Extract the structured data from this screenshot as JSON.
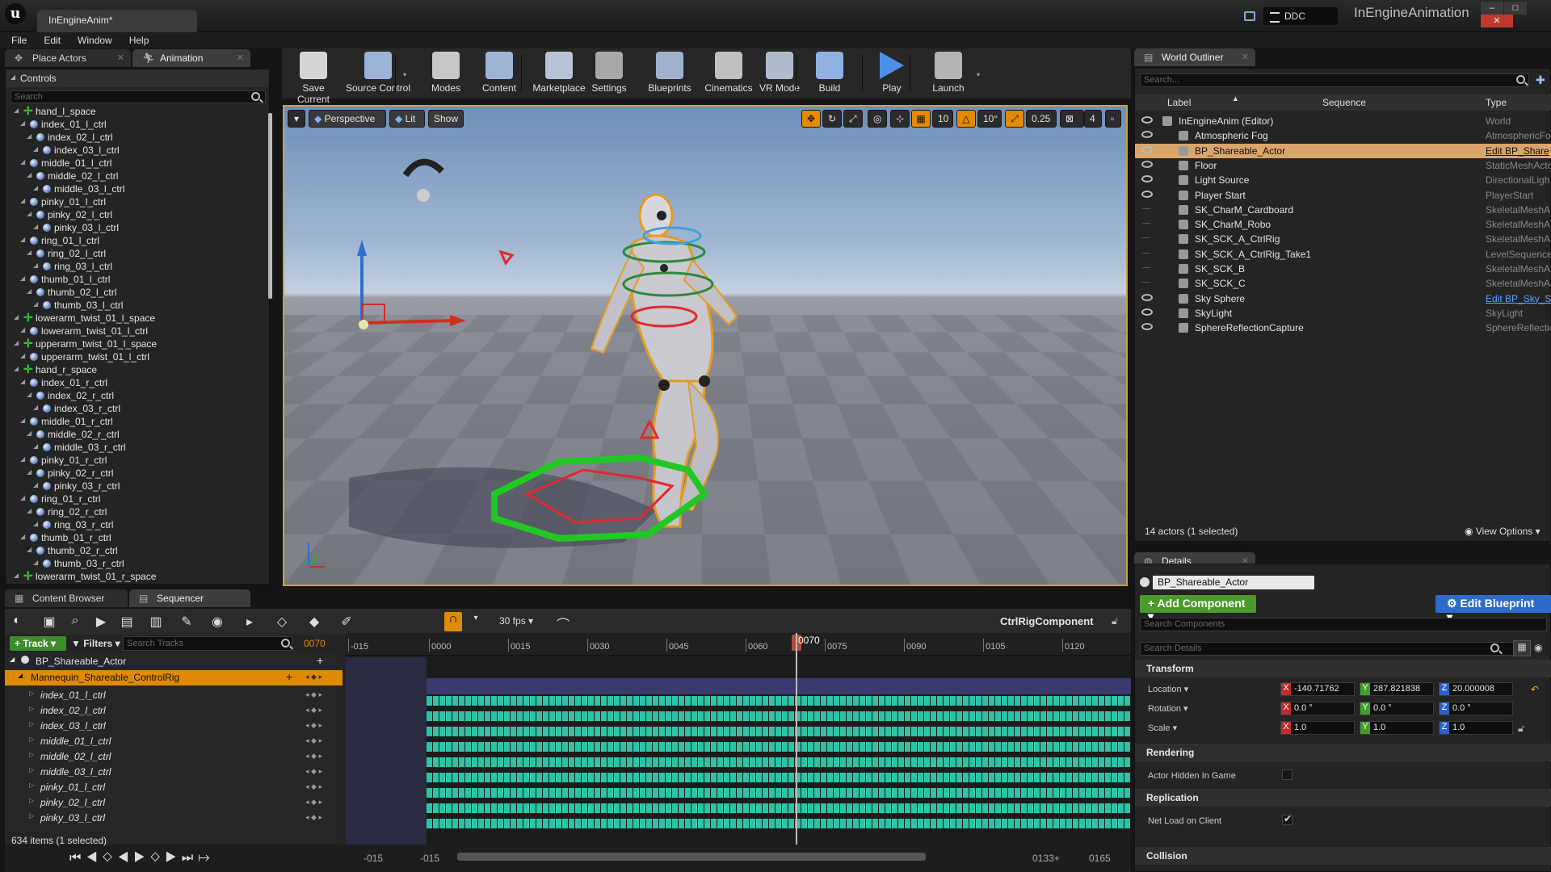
{
  "titlebar": {
    "doc_tab": "InEngineAnim*",
    "project": "InEngineAnimation",
    "ddc": "DDC"
  },
  "menu": [
    "File",
    "Edit",
    "Window",
    "Help"
  ],
  "left_tabs": {
    "place_actors": "Place Actors",
    "animation": "Animation"
  },
  "controls": {
    "header": "Controls",
    "search_placeholder": "Search",
    "items": [
      {
        "label": "hand_l_space",
        "depth": 0,
        "kind": "space"
      },
      {
        "label": "index_01_l_ctrl",
        "depth": 1,
        "kind": "ctrl"
      },
      {
        "label": "index_02_l_ctrl",
        "depth": 2,
        "kind": "ctrl"
      },
      {
        "label": "index_03_l_ctrl",
        "depth": 3,
        "kind": "ctrl"
      },
      {
        "label": "middle_01_l_ctrl",
        "depth": 1,
        "kind": "ctrl"
      },
      {
        "label": "middle_02_l_ctrl",
        "depth": 2,
        "kind": "ctrl"
      },
      {
        "label": "middle_03_l_ctrl",
        "depth": 3,
        "kind": "ctrl"
      },
      {
        "label": "pinky_01_l_ctrl",
        "depth": 1,
        "kind": "ctrl"
      },
      {
        "label": "pinky_02_l_ctrl",
        "depth": 2,
        "kind": "ctrl"
      },
      {
        "label": "pinky_03_l_ctrl",
        "depth": 3,
        "kind": "ctrl"
      },
      {
        "label": "ring_01_l_ctrl",
        "depth": 1,
        "kind": "ctrl"
      },
      {
        "label": "ring_02_l_ctrl",
        "depth": 2,
        "kind": "ctrl"
      },
      {
        "label": "ring_03_l_ctrl",
        "depth": 3,
        "kind": "ctrl"
      },
      {
        "label": "thumb_01_l_ctrl",
        "depth": 1,
        "kind": "ctrl"
      },
      {
        "label": "thumb_02_l_ctrl",
        "depth": 2,
        "kind": "ctrl"
      },
      {
        "label": "thumb_03_l_ctrl",
        "depth": 3,
        "kind": "ctrl"
      },
      {
        "label": "lowerarm_twist_01_l_space",
        "depth": 0,
        "kind": "space"
      },
      {
        "label": "lowerarm_twist_01_l_ctrl",
        "depth": 1,
        "kind": "ctrl"
      },
      {
        "label": "upperarm_twist_01_l_space",
        "depth": 0,
        "kind": "space"
      },
      {
        "label": "upperarm_twist_01_l_ctrl",
        "depth": 1,
        "kind": "ctrl"
      },
      {
        "label": "hand_r_space",
        "depth": 0,
        "kind": "space"
      },
      {
        "label": "index_01_r_ctrl",
        "depth": 1,
        "kind": "ctrl"
      },
      {
        "label": "index_02_r_ctrl",
        "depth": 2,
        "kind": "ctrl"
      },
      {
        "label": "index_03_r_ctrl",
        "depth": 3,
        "kind": "ctrl"
      },
      {
        "label": "middle_01_r_ctrl",
        "depth": 1,
        "kind": "ctrl"
      },
      {
        "label": "middle_02_r_ctrl",
        "depth": 2,
        "kind": "ctrl"
      },
      {
        "label": "middle_03_r_ctrl",
        "depth": 3,
        "kind": "ctrl"
      },
      {
        "label": "pinky_01_r_ctrl",
        "depth": 1,
        "kind": "ctrl"
      },
      {
        "label": "pinky_02_r_ctrl",
        "depth": 2,
        "kind": "ctrl"
      },
      {
        "label": "pinky_03_r_ctrl",
        "depth": 3,
        "kind": "ctrl"
      },
      {
        "label": "ring_01_r_ctrl",
        "depth": 1,
        "kind": "ctrl"
      },
      {
        "label": "ring_02_r_ctrl",
        "depth": 2,
        "kind": "ctrl"
      },
      {
        "label": "ring_03_r_ctrl",
        "depth": 3,
        "kind": "ctrl"
      },
      {
        "label": "thumb_01_r_ctrl",
        "depth": 1,
        "kind": "ctrl"
      },
      {
        "label": "thumb_02_r_ctrl",
        "depth": 2,
        "kind": "ctrl"
      },
      {
        "label": "thumb_03_r_ctrl",
        "depth": 3,
        "kind": "ctrl"
      },
      {
        "label": "lowerarm_twist_01_r_space",
        "depth": 0,
        "kind": "space"
      }
    ]
  },
  "toolbar": [
    {
      "label": "Save Current",
      "icon": "save-icon",
      "color": "#d6d6d6"
    },
    {
      "label": "Source Control",
      "icon": "source-control-icon",
      "color": "#9ab3d6"
    },
    {
      "label": "Modes",
      "icon": "modes-icon",
      "color": "#c8c8c8"
    },
    {
      "label": "Content",
      "icon": "content-icon",
      "color": "#9db4d6"
    },
    {
      "label": "Marketplace",
      "icon": "marketplace-icon",
      "color": "#b8c4d6"
    },
    {
      "label": "Settings",
      "icon": "settings-icon",
      "color": "#a8a8a8"
    },
    {
      "label": "Blueprints",
      "icon": "blueprints-icon",
      "color": "#9fb1cc"
    },
    {
      "label": "Cinematics",
      "icon": "cinematics-icon",
      "color": "#c0c0c0"
    },
    {
      "label": "VR Mode",
      "icon": "vr-mode-icon",
      "color": "#b0bccc"
    },
    {
      "label": "Build",
      "icon": "build-icon",
      "color": "#8fb0e0"
    },
    {
      "label": "Play",
      "icon": "play-icon",
      "color": "#4d8ee8"
    },
    {
      "label": "Launch",
      "icon": "launch-icon",
      "color": "#b4b4b4"
    }
  ],
  "viewport": {
    "perspective": "Perspective",
    "lit": "Lit",
    "show": "Show",
    "grid_snap": "10",
    "rot_snap": "10°",
    "scale_snap": "0.25",
    "cam_speed": "4"
  },
  "outliner": {
    "tab": "World Outliner",
    "search_placeholder": "Search...",
    "col_label": "Label",
    "col_sequence": "Sequence",
    "col_type": "Type",
    "rows": [
      {
        "label": "InEngineAnim (Editor)",
        "type": "World",
        "vis": true,
        "sel": false,
        "link": false
      },
      {
        "label": "Atmospheric Fog",
        "type": "AtmosphericFo",
        "vis": true,
        "sel": false,
        "link": false
      },
      {
        "label": "BP_Shareable_Actor",
        "type": "Edit BP_Share",
        "vis": true,
        "sel": true,
        "link": true
      },
      {
        "label": "Floor",
        "type": "StaticMeshActo",
        "vis": true,
        "sel": false,
        "link": false
      },
      {
        "label": "Light Source",
        "type": "DirectionalLigh",
        "vis": true,
        "sel": false,
        "link": false
      },
      {
        "label": "Player Start",
        "type": "PlayerStart",
        "vis": true,
        "sel": false,
        "link": false
      },
      {
        "label": "SK_CharM_Cardboard",
        "type": "SkeletalMeshA",
        "vis": false,
        "sel": false,
        "link": false
      },
      {
        "label": "SK_CharM_Robo",
        "type": "SkeletalMeshA",
        "vis": false,
        "sel": false,
        "link": false
      },
      {
        "label": "SK_SCK_A_CtrlRig",
        "type": "SkeletalMeshA",
        "vis": false,
        "sel": false,
        "link": false
      },
      {
        "label": "SK_SCK_A_CtrlRig_Take1",
        "type": "LevelSequence",
        "vis": false,
        "sel": false,
        "link": false
      },
      {
        "label": "SK_SCK_B",
        "type": "SkeletalMeshA",
        "vis": false,
        "sel": false,
        "link": false
      },
      {
        "label": "SK_SCK_C",
        "type": "SkeletalMeshA",
        "vis": false,
        "sel": false,
        "link": false
      },
      {
        "label": "Sky Sphere",
        "type": "Edit BP_Sky_S",
        "vis": true,
        "sel": false,
        "link": true
      },
      {
        "label": "SkyLight",
        "type": "SkyLight",
        "vis": true,
        "sel": false,
        "link": false
      },
      {
        "label": "SphereReflectionCapture",
        "type": "SphereReflectic",
        "vis": true,
        "sel": false,
        "link": false
      }
    ],
    "status": "14 actors (1 selected)",
    "view_options": "View Options"
  },
  "details": {
    "tab": "Details",
    "actor_name": "BP_Shareable_Actor",
    "add_component": "+ Add Component",
    "edit_blueprint": "Edit Blueprint",
    "search_components": "Search Components",
    "search_details": "Search Details",
    "transform": "Transform",
    "location_label": "Location",
    "rotation_label": "Rotation",
    "scale_label": "Scale",
    "location": {
      "x": "-140.71762",
      "y": "287.821838",
      "z": "20.000008"
    },
    "rotation": {
      "x": "0.0 °",
      "y": "0.0 °",
      "z": "0.0 °"
    },
    "scale": {
      "x": "1.0",
      "y": "1.0",
      "z": "1.0"
    },
    "rendering": "Rendering",
    "actor_hidden": "Actor Hidden In Game",
    "replication": "Replication",
    "net_load": "Net Load on Client",
    "collision": "Collision"
  },
  "bottom_tabs": {
    "content_browser": "Content Browser",
    "sequencer": "Sequencer"
  },
  "sequencer": {
    "fps": "30 fps",
    "component": "CtrlRigComponent",
    "track_btn": "+ Track",
    "filters_btn": "Filters",
    "search_tracks": "Search Tracks",
    "current_frame": "0070",
    "actor_track": "BP_Shareable_Actor",
    "rig_track": "Mannequin_Shareable_ControlRig",
    "tracks": [
      "index_01_l_ctrl",
      "index_02_l_ctrl",
      "index_03_l_ctrl",
      "middle_01_l_ctrl",
      "middle_02_l_ctrl",
      "middle_03_l_ctrl",
      "pinky_01_l_ctrl",
      "pinky_02_l_ctrl",
      "pinky_03_l_ctrl"
    ],
    "ruler": [
      "-015",
      "0000",
      "0015",
      "0030",
      "0045",
      "0060",
      "0075",
      "0090",
      "0105",
      "0120"
    ],
    "playhead_label": "0070",
    "status": "634 items (1 selected)",
    "range_start": "-015",
    "range_start2": "-015",
    "range_end": "0133+",
    "range_end2": "0165"
  }
}
